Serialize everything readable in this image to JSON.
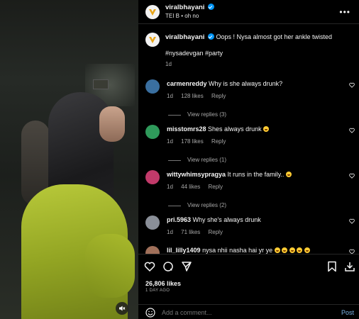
{
  "post": {
    "username": "viralbhayani",
    "audio": "TEI B • oh no",
    "caption": "Oops ! Nysa almost got her ankle twisted",
    "hashtags": "#nysadevgan #party",
    "caption_time": "1d"
  },
  "comments": [
    {
      "user": "carmenreddy",
      "text": "Why is she always drunk?",
      "emoji": "",
      "time": "1d",
      "likes": "128 likes",
      "reply": "Reply",
      "view_replies": "View replies (3)",
      "avatar_color": "#3a6fa0"
    },
    {
      "user": "misstomrs28",
      "text": "Shes always drunk",
      "emoji": "laugh",
      "time": "1d",
      "likes": "178 likes",
      "reply": "Reply",
      "view_replies": "View replies (1)",
      "avatar_color": "#2f9a5b"
    },
    {
      "user": "wittywhimsypragya",
      "text": "It runs in the family..",
      "emoji": "laugh",
      "time": "1d",
      "likes": "44 likes",
      "reply": "Reply",
      "view_replies": "View replies (2)",
      "avatar_color": "#c23a6a"
    },
    {
      "user": "pri.5963",
      "text": "Why she's always drunk",
      "emoji": "",
      "time": "1d",
      "likes": "71 likes",
      "reply": "Reply",
      "view_replies": "",
      "avatar_color": "#8a8f98"
    },
    {
      "user": "lil_lilly1409",
      "text": "nysa nhii nasha hai yr ye",
      "emoji": "laugh5",
      "time": "",
      "likes": "",
      "reply": "",
      "view_replies": "",
      "avatar_color": "#a0705a"
    }
  ],
  "actions": {
    "likes": "26,806 likes",
    "ago": "1 DAY AGO",
    "comment_placeholder": "Add a comment...",
    "post_label": "Post"
  },
  "colors": {
    "accent": "#0095f6",
    "post_link": "#7cb4e8",
    "muted": "#a8a8a8"
  },
  "icons": [
    "mute-icon",
    "more-icon",
    "heart-icon",
    "comment-icon",
    "share-icon",
    "bookmark-icon",
    "download-icon",
    "emoji-icon",
    "verified-icon"
  ]
}
